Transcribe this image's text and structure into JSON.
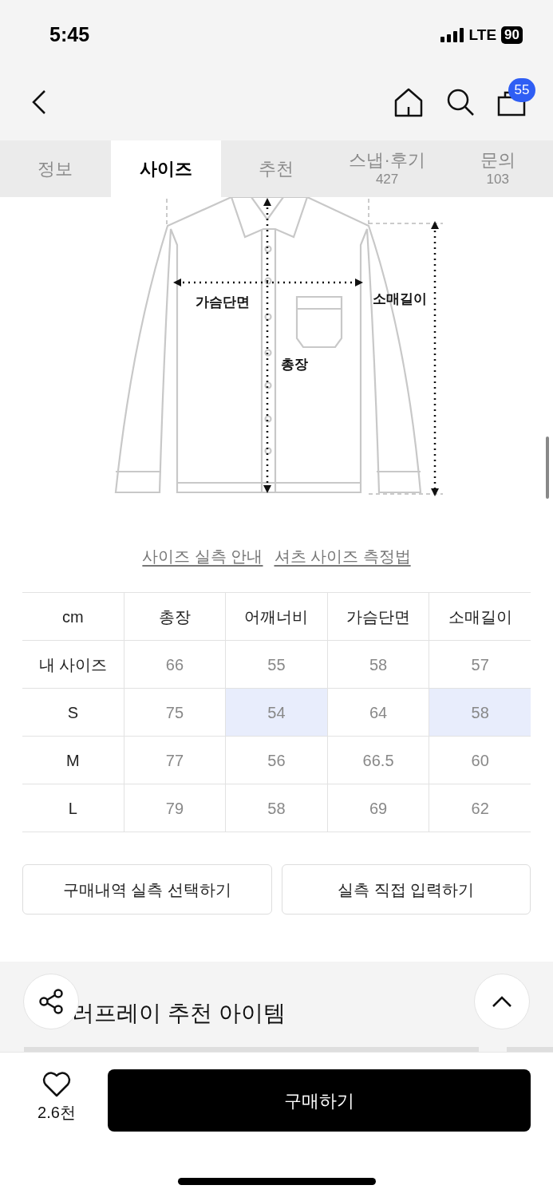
{
  "status_bar": {
    "time": "5:45",
    "network": "LTE",
    "battery": "90"
  },
  "nav": {
    "cart_count": "55"
  },
  "tabs": [
    {
      "label": "정보",
      "selected": false
    },
    {
      "label": "사이즈",
      "selected": true
    },
    {
      "label": "추천",
      "selected": false
    },
    {
      "label": "스냅·후기",
      "count": "427",
      "selected": false
    },
    {
      "label": "문의",
      "count": "103",
      "selected": false
    }
  ],
  "diagram": {
    "labels": [
      "가슴단면",
      "소매길이",
      "총장"
    ]
  },
  "links": [
    "사이즈 실측 안내",
    "셔츠 사이즈 측정법"
  ],
  "size_table": {
    "columns": [
      "cm",
      "총장",
      "어깨너비",
      "가슴단면",
      "소매길이"
    ],
    "rows": [
      {
        "cells": [
          {
            "text": "내 사이즈",
            "highlighted": false
          },
          {
            "text": "66",
            "highlighted": false
          },
          {
            "text": "55",
            "highlighted": false
          },
          {
            "text": "58",
            "highlighted": false
          },
          {
            "text": "57",
            "highlighted": false
          }
        ]
      },
      {
        "cells": [
          {
            "text": "S",
            "highlighted": false
          },
          {
            "text": "75",
            "highlighted": false
          },
          {
            "text": "54",
            "highlighted": true
          },
          {
            "text": "64",
            "highlighted": false
          },
          {
            "text": "58",
            "highlighted": true
          }
        ]
      },
      {
        "cells": [
          {
            "text": "M",
            "highlighted": false
          },
          {
            "text": "77",
            "highlighted": false
          },
          {
            "text": "56",
            "highlighted": false
          },
          {
            "text": "66.5",
            "highlighted": false
          },
          {
            "text": "60",
            "highlighted": false
          }
        ]
      },
      {
        "cells": [
          {
            "text": "L",
            "highlighted": false
          },
          {
            "text": "79",
            "highlighted": false
          },
          {
            "text": "58",
            "highlighted": false
          },
          {
            "text": "69",
            "highlighted": false
          },
          {
            "text": "62",
            "highlighted": false
          }
        ]
      }
    ]
  },
  "actions": [
    "구매내역 실측 선택하기",
    "실측 직접 입력하기"
  ],
  "recommend": {
    "title": "러프레이 추천 아이템"
  },
  "bottom_bar": {
    "likes": "2.6천",
    "buy": "구매하기"
  }
}
